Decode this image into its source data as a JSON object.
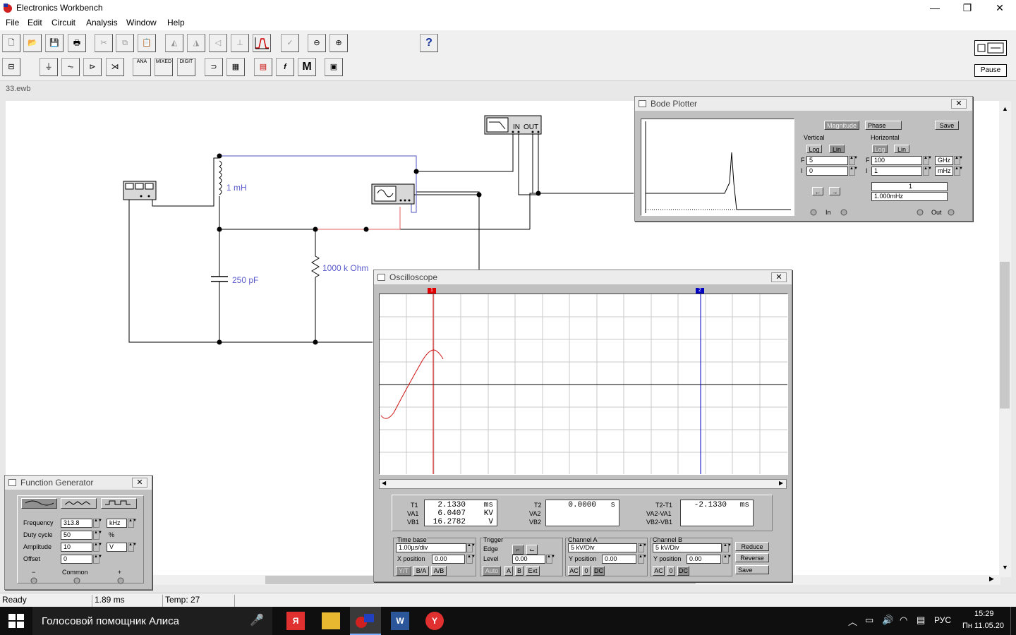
{
  "app": {
    "title": "Electronics Workbench",
    "window_controls": [
      "—",
      "❐",
      "✕"
    ]
  },
  "menu": [
    "File",
    "Edit",
    "Circuit",
    "Analysis",
    "Window",
    "Help"
  ],
  "toolbar": {
    "help_label": "?",
    "pause_label": "Pause",
    "parts": {
      "ana": "ANA",
      "mixed": "MIXED",
      "digit": "DIGIT",
      "func": "f",
      "misc": "M"
    }
  },
  "document": {
    "tab": "33.ewb"
  },
  "circuit": {
    "inductor_label": "1 mH",
    "capacitor_label": "250 pF",
    "resistor_label": "1000 k Ohm",
    "bode_in": "IN",
    "bode_out": "OUT"
  },
  "bode": {
    "title": "Bode Plotter",
    "magnitude": "Magnitude",
    "phase": "Phase",
    "save": "Save",
    "vertical": "Vertical",
    "horizontal": "Horizontal",
    "log": "Log",
    "lin": "Lin",
    "v_f_label": "F",
    "v_i_label": "I",
    "v_f_value": "5",
    "v_i_value": "0",
    "h_f_value": "100",
    "h_i_value": "1",
    "h_f_unit": "GHz",
    "h_i_unit": "mHz",
    "readout_value": "1",
    "readout_freq": "1.000mHz",
    "in_label": "In",
    "out_label": "Out"
  },
  "oscilloscope": {
    "title": "Oscilloscope",
    "t1_label": "T1",
    "va1_label": "VA1",
    "vb1_label": "VB1",
    "t1": "2.1330",
    "t1_unit": "ms",
    "va1": "6.0407",
    "va1_unit": "KV",
    "vb1": "16.2782",
    "vb1_unit": "V",
    "t2_label": "T2",
    "va2_label": "VA2",
    "vb2_label": "VB2",
    "t2": "0.0000",
    "t2_unit": "s",
    "dt_label": "T2-T1",
    "dva_label": "VA2-VA1",
    "dvb_label": "VB2-VB1",
    "dt": "-2.1330",
    "dt_unit": "ms",
    "timebase_label": "Time base",
    "timebase": "1.00µs/div",
    "xpos_label": "X position",
    "xpos": "0.00",
    "yt": "Y/T",
    "ba": "B/A",
    "ab": "A/B",
    "trigger_label": "Trigger",
    "edge_label": "Edge",
    "level_label": "Level",
    "level": "0.00",
    "auto": "Auto",
    "trig_a": "A",
    "trig_b": "B",
    "trig_ext": "Ext",
    "cha_label": "Channel A",
    "cha_scale": "5 kV/Div",
    "cha_ypos_label": "Y position",
    "cha_ypos": "0.00",
    "chb_label": "Channel B",
    "chb_scale": "5 kV/Div",
    "chb_ypos_label": "Y position",
    "chb_ypos": "0.00",
    "ac": "AC",
    "zero": "0",
    "dc": "DC",
    "reduce": "Reduce",
    "reverse": "Reverse",
    "save": "Save",
    "cursor1": "1",
    "cursor2": "2"
  },
  "funcgen": {
    "title": "Function Generator",
    "frequency_label": "Frequency",
    "frequency": "313.8",
    "frequency_unit": "kHz",
    "duty_label": "Duty cycle",
    "duty": "50",
    "duty_unit": "%",
    "amplitude_label": "Amplitude",
    "amplitude": "10",
    "amplitude_unit": "V",
    "offset_label": "Offset",
    "offset": "0",
    "minus": "−",
    "common": "Common",
    "plus": "+"
  },
  "status": {
    "state": "Ready",
    "time": "1.89 ms",
    "temp": "Temp:  27"
  },
  "taskbar": {
    "search_text": "Голосовой помощник Алиса",
    "lang": "РУС",
    "time": "15:29",
    "date": "Пн 11.05.20"
  },
  "colors": {
    "trace": "#d01010",
    "cursor1": "#e00000",
    "cursor2": "#0000c0",
    "wire": "#000000",
    "wire_blue": "#5050c0",
    "wire_red": "#e06060"
  }
}
